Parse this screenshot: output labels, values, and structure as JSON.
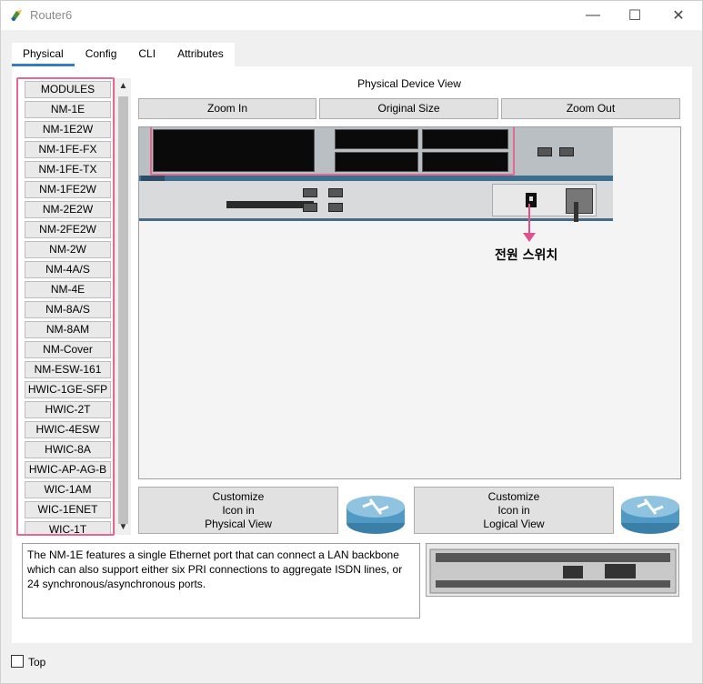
{
  "window": {
    "title": "Router6",
    "minimize_glyph": "—",
    "maximize_glyph": "☐",
    "close_glyph": "✕"
  },
  "tabs": [
    {
      "label": "Physical",
      "active": true
    },
    {
      "label": "Config",
      "active": false
    },
    {
      "label": "CLI",
      "active": false
    },
    {
      "label": "Attributes",
      "active": false
    }
  ],
  "modules": {
    "items": [
      "MODULES",
      "NM-1E",
      "NM-1E2W",
      "NM-1FE-FX",
      "NM-1FE-TX",
      "NM-1FE2W",
      "NM-2E2W",
      "NM-2FE2W",
      "NM-2W",
      "NM-4A/S",
      "NM-4E",
      "NM-8A/S",
      "NM-8AM",
      "NM-Cover",
      "NM-ESW-161",
      "HWIC-1GE-SFP",
      "HWIC-2T",
      "HWIC-4ESW",
      "HWIC-8A",
      "HWIC-AP-AG-B",
      "WIC-1AM",
      "WIC-1ENET",
      "WIC-1T"
    ],
    "scroll_up_glyph": "▲",
    "scroll_down_glyph": "▼"
  },
  "physical_view": {
    "title": "Physical Device View",
    "zoom_in": "Zoom In",
    "original_size": "Original Size",
    "zoom_out": "Zoom Out",
    "annotation_label": "전원 스위치",
    "annotation_color": "#e0508a"
  },
  "customize": {
    "physical": "Customize\nIcon in\nPhysical View",
    "logical": "Customize\nIcon in\nLogical View"
  },
  "description": "The NM-1E features a single Ethernet port that can connect a LAN backbone which can also support either six PRI connections to aggregate ISDN lines, or 24 synchronous/asynchronous ports.",
  "footer": {
    "top_label": "Top",
    "top_checked": false
  },
  "colors": {
    "highlight": "#e4688f",
    "tab_accent": "#3a79c6"
  }
}
